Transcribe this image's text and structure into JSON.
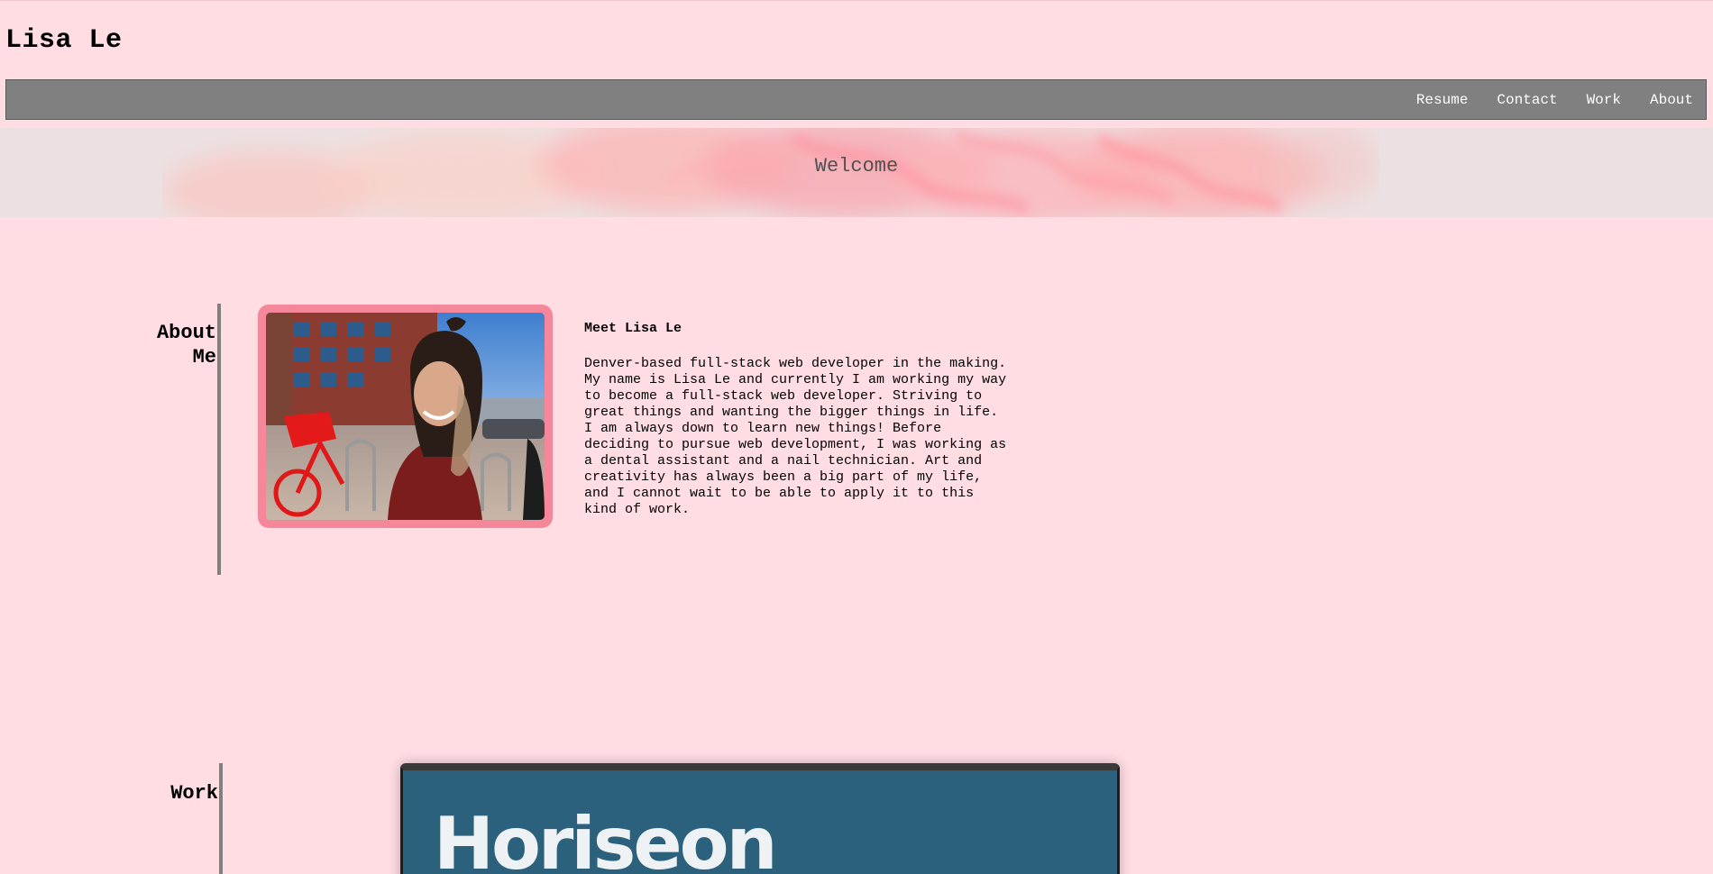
{
  "header": {
    "title": "Lisa Le"
  },
  "nav": {
    "items": [
      {
        "label": "Resume"
      },
      {
        "label": "Contact"
      },
      {
        "label": "Work"
      },
      {
        "label": "About"
      }
    ]
  },
  "hero": {
    "title": "Welcome"
  },
  "about": {
    "heading": "About Me",
    "title": "Meet Lisa Le",
    "body": "Denver-based full-stack web developer in the making.\nMy name is Lisa Le and currently I am working my way\nto become a full-stack web developer. Striving to\ngreat things and wanting the bigger things in life.\nI am always down to learn new things! Before\ndeciding to pursue web development, I was working as\na dental assistant and a nail technician. Art and\ncreativity has always been a big part of my life,\nand I cannot wait to be able to apply it to this\nkind of work."
  },
  "work": {
    "heading": "Work",
    "project_title": "Horiseon"
  },
  "colors": {
    "background": "#ffdde3",
    "navbar": "#808080",
    "photo_frame": "#f5879a",
    "work_card": "#2b617c"
  }
}
